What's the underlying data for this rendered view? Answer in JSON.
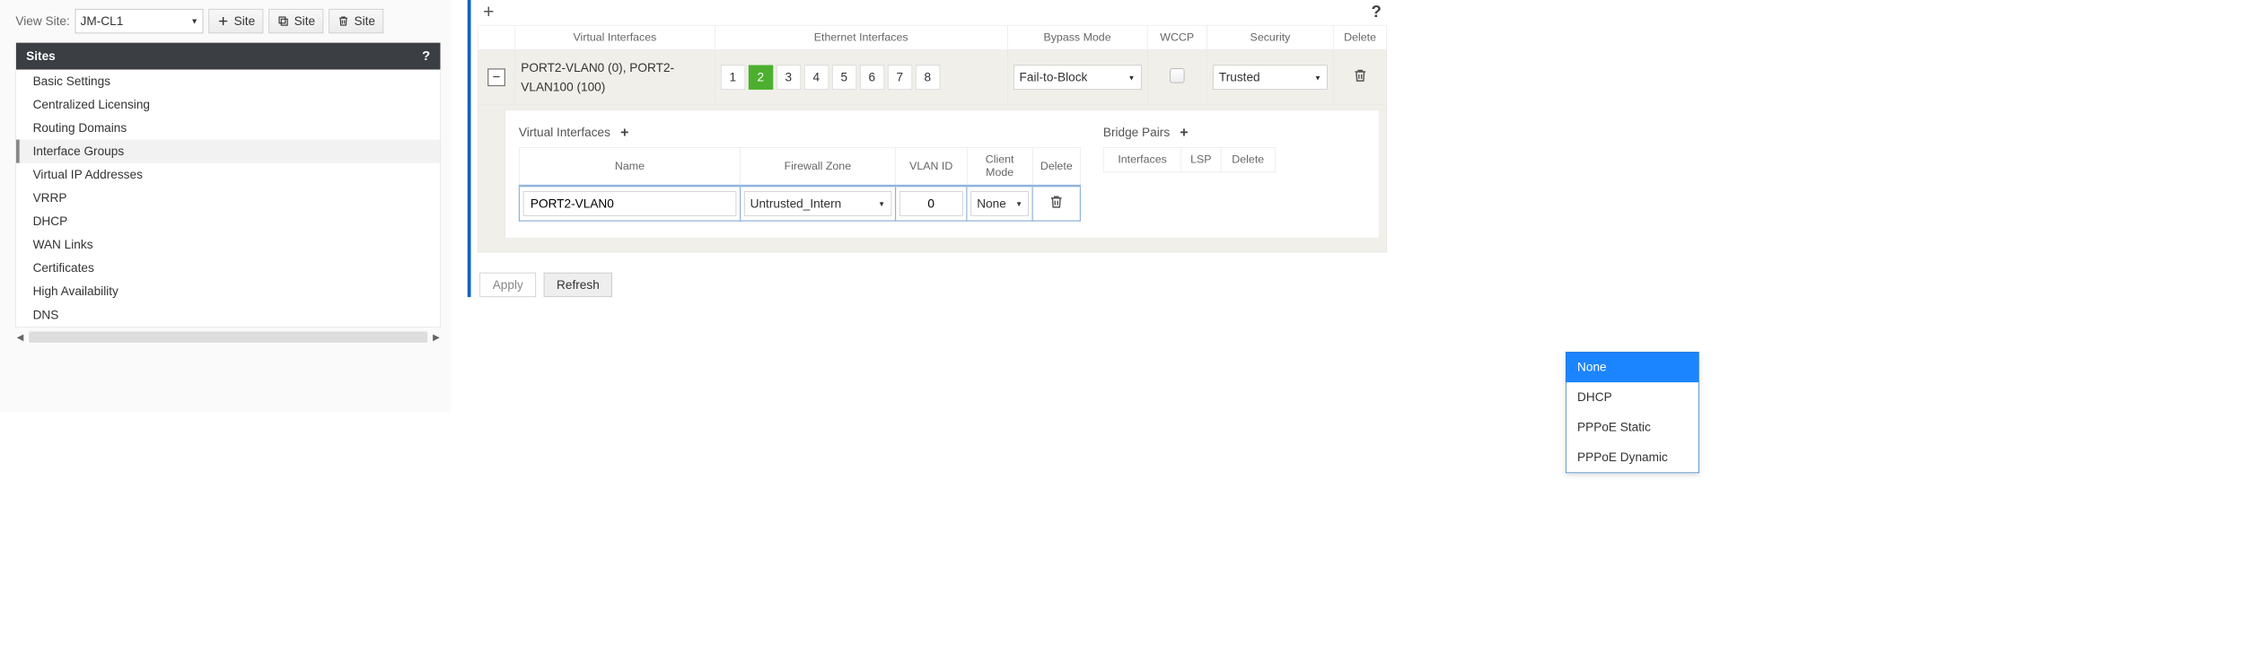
{
  "sitebar": {
    "label": "View Site:",
    "selected_site": "JM-CL1",
    "add_label": "Site",
    "clone_label": "Site",
    "delete_label": "Site"
  },
  "nav": {
    "header": "Sites",
    "help": "?",
    "items": [
      {
        "label": "Basic Settings"
      },
      {
        "label": "Centralized Licensing"
      },
      {
        "label": "Routing Domains"
      },
      {
        "label": "Interface Groups",
        "active": true
      },
      {
        "label": "Virtual IP Addresses"
      },
      {
        "label": "VRRP"
      },
      {
        "label": "DHCP"
      },
      {
        "label": "WAN Links"
      },
      {
        "label": "Certificates"
      },
      {
        "label": "High Availability"
      },
      {
        "label": "DNS"
      }
    ]
  },
  "grid": {
    "topbar_plus": "+",
    "topbar_help": "?",
    "columns": {
      "virtual_interfaces": "Virtual Interfaces",
      "ethernet_interfaces": "Ethernet Interfaces",
      "bypass_mode": "Bypass Mode",
      "wccp": "WCCP",
      "security": "Security",
      "delete": "Delete"
    },
    "row": {
      "expand_state": "−",
      "vi_text": "PORT2-VLAN0 (0), PORT2-VLAN100 (100)",
      "ports": [
        "1",
        "2",
        "3",
        "4",
        "5",
        "6",
        "7",
        "8"
      ],
      "selected_port": "2",
      "bypass_mode": "Fail-to-Block",
      "wccp_checked": false,
      "security": "Trusted"
    }
  },
  "sub": {
    "vi_title": "Virtual Interfaces",
    "bp_title": "Bridge Pairs",
    "plus": "+",
    "vi_cols": {
      "name": "Name",
      "zone": "Firewall Zone",
      "vlan": "VLAN ID",
      "mode": "Client Mode",
      "delete": "Delete"
    },
    "bp_cols": {
      "interfaces": "Interfaces",
      "lsp": "LSP",
      "delete": "Delete"
    },
    "vi_row": {
      "name": "PORT2-VLAN0",
      "zone": "Untrusted_Intern",
      "vlan": "0",
      "mode": "None"
    },
    "mode_options": [
      "None",
      "DHCP",
      "PPPoE Static",
      "PPPoE Dynamic"
    ],
    "mode_selected": "None"
  },
  "actions": {
    "apply": "Apply",
    "refresh": "Refresh"
  }
}
